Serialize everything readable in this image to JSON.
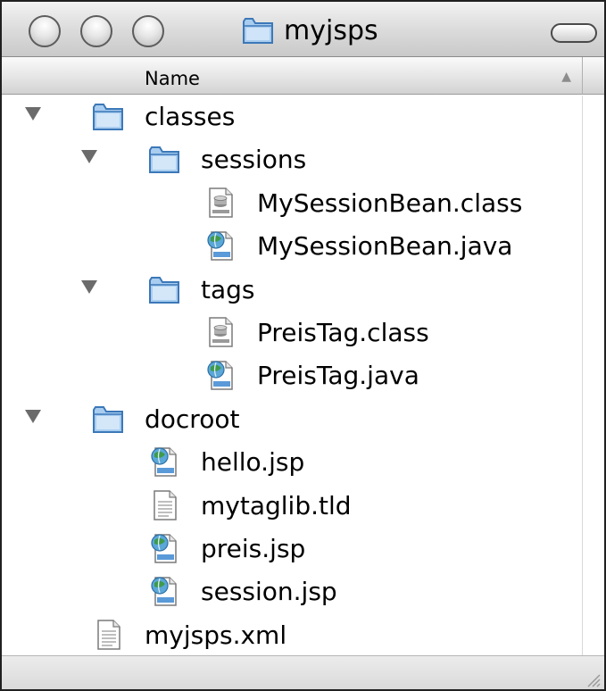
{
  "window": {
    "title": "myjsps"
  },
  "columns": {
    "name": "Name"
  },
  "rows": [
    {
      "label": "classes",
      "kind": "folder",
      "depth": 0,
      "expanded": true
    },
    {
      "label": "sessions",
      "kind": "folder",
      "depth": 1,
      "expanded": true
    },
    {
      "label": "MySessionBean.class",
      "kind": "class-file",
      "depth": 2
    },
    {
      "label": "MySessionBean.java",
      "kind": "java-file",
      "depth": 2
    },
    {
      "label": "tags",
      "kind": "folder",
      "depth": 1,
      "expanded": true
    },
    {
      "label": "PreisTag.class",
      "kind": "class-file",
      "depth": 2
    },
    {
      "label": "PreisTag.java",
      "kind": "java-file",
      "depth": 2
    },
    {
      "label": "docroot",
      "kind": "folder",
      "depth": 0,
      "expanded": true
    },
    {
      "label": "hello.jsp",
      "kind": "java-file",
      "depth": 1
    },
    {
      "label": "mytaglib.tld",
      "kind": "text-file",
      "depth": 1
    },
    {
      "label": "preis.jsp",
      "kind": "java-file",
      "depth": 1
    },
    {
      "label": "session.jsp",
      "kind": "java-file",
      "depth": 1
    },
    {
      "label": "myjsps.xml",
      "kind": "text-file",
      "depth": 0
    }
  ],
  "icons": {
    "folder": "folder-icon",
    "class-file": "class-file-icon",
    "java-file": "java-file-icon",
    "text-file": "text-file-icon"
  },
  "colors": {
    "folder_fill": "#a9cdf0",
    "folder_edge": "#3c78b8",
    "disclosure": "#6b6b6b"
  }
}
